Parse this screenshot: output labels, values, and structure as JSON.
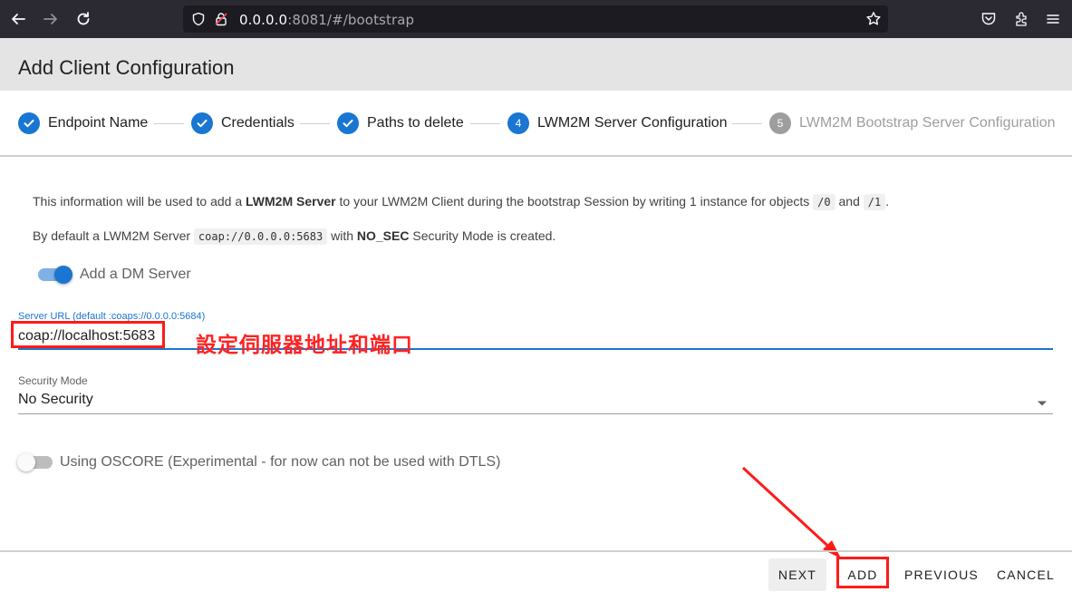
{
  "browser": {
    "url_host": "0.0.0.0",
    "url_rest": ":8081/#/bootstrap"
  },
  "dialog": {
    "title": "Add Client Configuration"
  },
  "stepper": {
    "steps": [
      {
        "number": "1",
        "label": "Endpoint Name",
        "state": "done"
      },
      {
        "number": "2",
        "label": "Credentials",
        "state": "done"
      },
      {
        "number": "3",
        "label": "Paths to delete",
        "state": "done"
      },
      {
        "number": "4",
        "label": "LWM2M Server Configuration",
        "state": "active"
      },
      {
        "number": "5",
        "label": "LWM2M Bootstrap Server Configuration",
        "state": "disabled"
      }
    ]
  },
  "info": {
    "line1_a": "This information will be used to add a ",
    "line1_b": "LWM2M Server",
    "line1_c": " to your LWM2M Client during the bootstrap Session by writing 1 instance for objects ",
    "line1_code1": "/0",
    "line1_and": " and ",
    "line1_code2": "/1",
    "line1_end": ".",
    "line2_a": "By default a LWM2M Server ",
    "line2_code": "coap://0.0.0.0:5683",
    "line2_b": " with ",
    "line2_c": "NO_SEC",
    "line2_d": " Security Mode is created."
  },
  "dm_toggle": {
    "label": "Add a DM Server",
    "checked": true
  },
  "server_url": {
    "label": "Server URL (default :coaps://0.0.0.0:5684)",
    "value": "coap://localhost:5683"
  },
  "annotation": {
    "text": "設定伺服器地址和端口"
  },
  "security_mode": {
    "label": "Security Mode",
    "value": "No Security"
  },
  "oscore_toggle": {
    "label": "Using OSCORE (Experimental - for now can not be used with DTLS)",
    "checked": false
  },
  "buttons": {
    "next": "NEXT",
    "add": "ADD",
    "previous": "PREVIOUS",
    "cancel": "CANCEL"
  },
  "colors": {
    "primary": "#1976d2",
    "annotation_red": "#ff1a1a",
    "browser_bg": "#2b2a33"
  }
}
